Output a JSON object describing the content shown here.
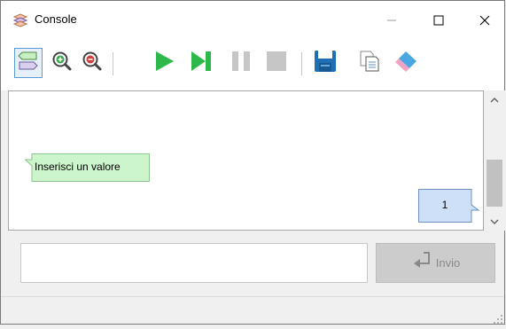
{
  "window": {
    "title": "Console",
    "controls": {
      "minimize": "minimize",
      "maximize": "maximize",
      "close": "close"
    }
  },
  "toolbar": {
    "tools": [
      {
        "name": "input-tool",
        "icon": "speech-bubble-icon",
        "active": true
      },
      {
        "name": "zoom-in",
        "icon": "zoom-in-icon"
      },
      {
        "name": "zoom-out",
        "icon": "zoom-out-icon"
      },
      {
        "name": "run",
        "icon": "play-icon"
      },
      {
        "name": "step",
        "icon": "step-icon"
      },
      {
        "name": "pause",
        "icon": "pause-icon"
      },
      {
        "name": "stop",
        "icon": "stop-icon"
      },
      {
        "name": "save",
        "icon": "save-icon"
      },
      {
        "name": "copy",
        "icon": "copy-icon"
      },
      {
        "name": "clear",
        "icon": "eraser-icon"
      }
    ]
  },
  "console": {
    "prompt_text": "Inserisci un valore",
    "value_text": "1"
  },
  "input": {
    "value": "",
    "placeholder": ""
  },
  "send_button": {
    "label": "Invio",
    "enabled": false
  },
  "colors": {
    "prompt_bubble": "#ccf5cc",
    "value_bubble": "#cde0f7",
    "run_green": "#2db84b",
    "save_blue": "#1f6fb5"
  }
}
